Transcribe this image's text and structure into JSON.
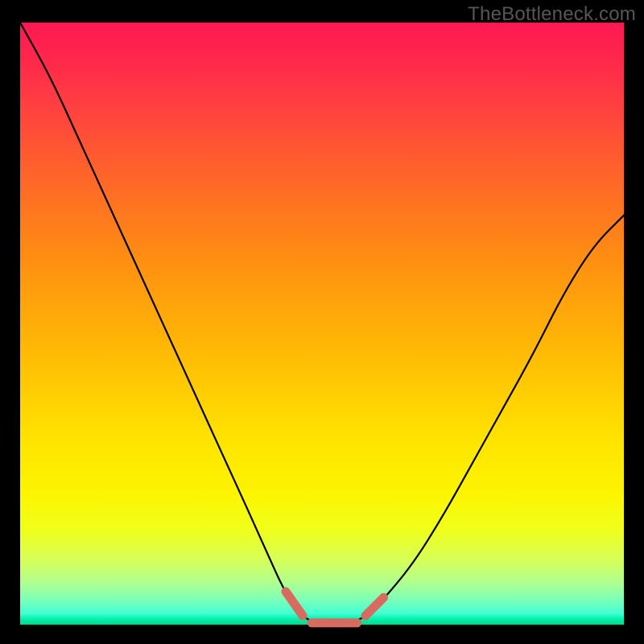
{
  "watermark": "TheBottleneck.com",
  "colors": {
    "curve": "#000000",
    "accent": "#d86a60",
    "gradient_top": "#ff1852",
    "gradient_bottom": "#02d891"
  },
  "chart_data": {
    "type": "line",
    "title": "",
    "xlabel": "",
    "ylabel": "",
    "xlim": [
      0,
      1
    ],
    "ylim": [
      0,
      100
    ],
    "note": "V-shaped bottleneck curve. x is horizontal fraction (0=left edge, 1=right edge). y is bottleneck percentage (0=optimal/green bottom, 100=worst/red top). Left branch descends steeply to a flat optimal zone around x≈0.47–0.57, then right branch rises.",
    "series": [
      {
        "name": "bottleneck",
        "x": [
          0.0,
          0.05,
          0.1,
          0.15,
          0.2,
          0.25,
          0.3,
          0.35,
          0.4,
          0.44,
          0.47,
          0.5,
          0.53,
          0.57,
          0.6,
          0.65,
          0.7,
          0.75,
          0.8,
          0.85,
          0.9,
          0.95,
          1.0
        ],
        "y": [
          100,
          91,
          80,
          69,
          58,
          47,
          36,
          25,
          14,
          5,
          1,
          0,
          0,
          1,
          4,
          10,
          18,
          27,
          36,
          45,
          55,
          63,
          68
        ]
      }
    ],
    "accent_region": {
      "description": "Thick salmon-colored highlight over the curve near the optimal valley, drawn as three short dashed segments",
      "segments": [
        {
          "x": [
            0.44,
            0.468
          ],
          "y": [
            5.5,
            1.5
          ]
        },
        {
          "x": [
            0.483,
            0.558
          ],
          "y": [
            0.3,
            0.3
          ]
        },
        {
          "x": [
            0.572,
            0.602
          ],
          "y": [
            1.5,
            4.5
          ]
        }
      ]
    }
  }
}
